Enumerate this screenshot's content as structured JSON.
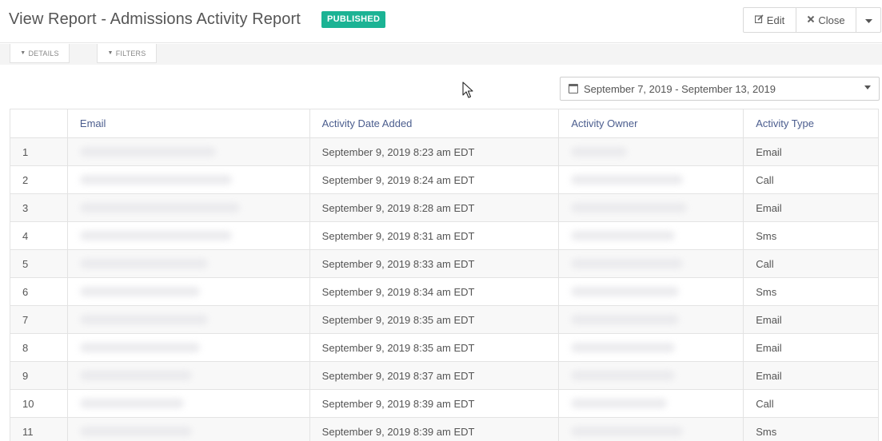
{
  "header": {
    "title": "View Report - Admissions Activity Report",
    "status_badge": "PUBLISHED",
    "edit_label": "Edit",
    "close_label": "Close"
  },
  "tabs": {
    "details_label": "DETAILS",
    "filters_label": "FILTERS"
  },
  "date_range": {
    "value": "September 7, 2019 - September 13, 2019"
  },
  "table": {
    "columns": [
      "",
      "Email",
      "Activity Date Added",
      "Activity Owner",
      "Activity Type"
    ],
    "rows": [
      {
        "num": "1",
        "date": "September 9, 2019 8:23 am EDT",
        "type": "Email"
      },
      {
        "num": "2",
        "date": "September 9, 2019 8:24 am EDT",
        "type": "Call"
      },
      {
        "num": "3",
        "date": "September 9, 2019 8:28 am EDT",
        "type": "Email"
      },
      {
        "num": "4",
        "date": "September 9, 2019 8:31 am EDT",
        "type": "Sms"
      },
      {
        "num": "5",
        "date": "September 9, 2019 8:33 am EDT",
        "type": "Call"
      },
      {
        "num": "6",
        "date": "September 9, 2019 8:34 am EDT",
        "type": "Sms"
      },
      {
        "num": "7",
        "date": "September 9, 2019 8:35 am EDT",
        "type": "Email"
      },
      {
        "num": "8",
        "date": "September 9, 2019 8:35 am EDT",
        "type": "Email"
      },
      {
        "num": "9",
        "date": "September 9, 2019 8:37 am EDT",
        "type": "Email"
      },
      {
        "num": "10",
        "date": "September 9, 2019 8:39 am EDT",
        "type": "Call"
      },
      {
        "num": "11",
        "date": "September 9, 2019 8:39 am EDT",
        "type": "Sms"
      }
    ]
  },
  "colors": {
    "badge": "#1bb394",
    "header_text": "#4b5d8e"
  }
}
